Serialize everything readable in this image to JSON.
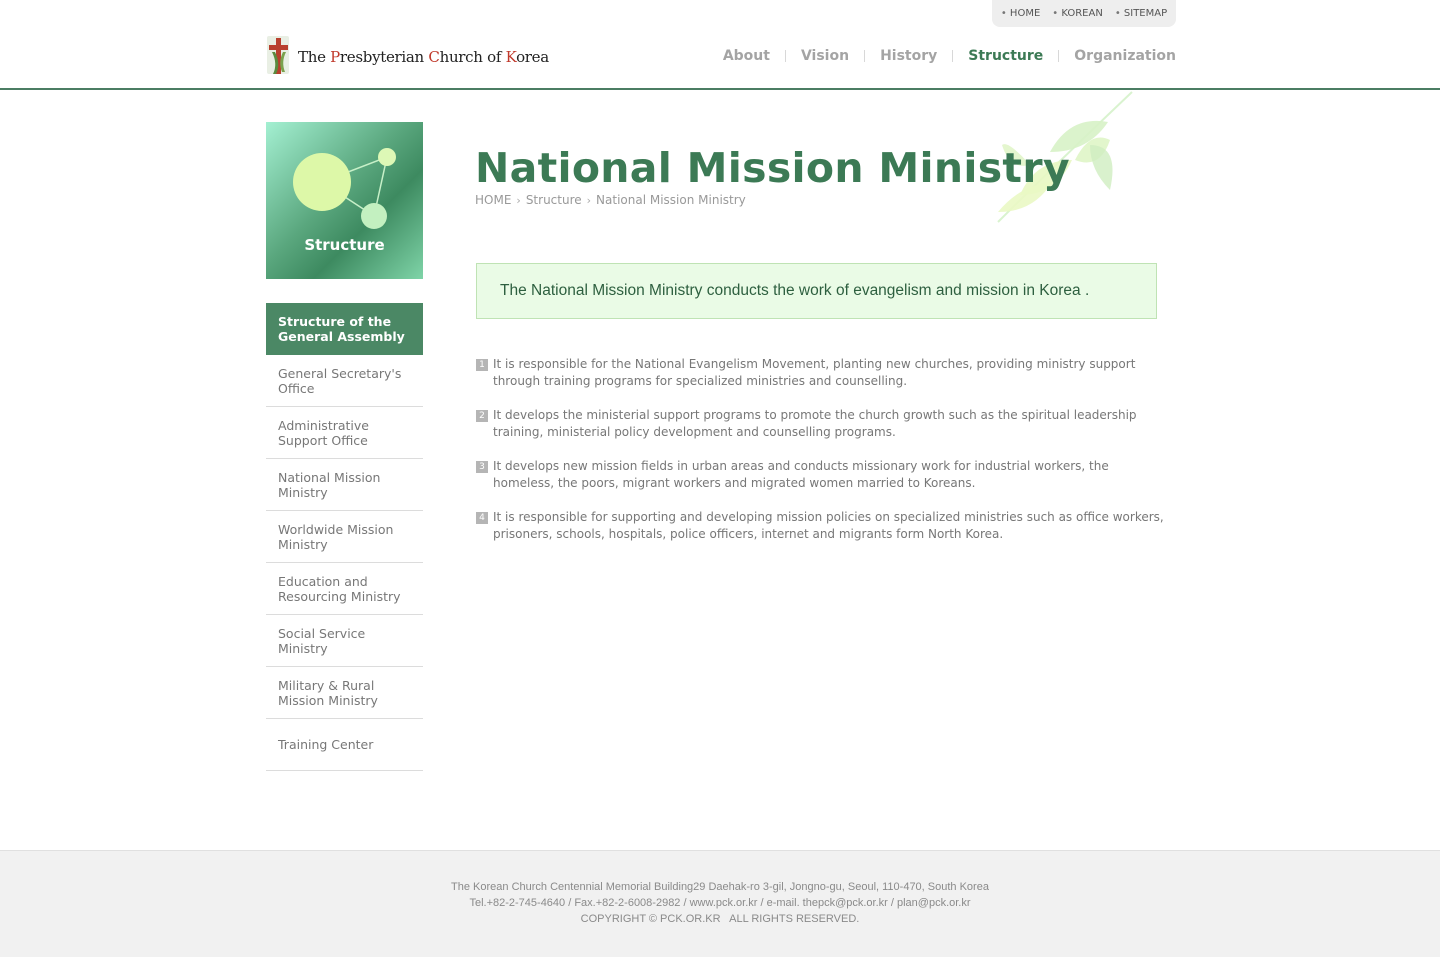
{
  "util_nav": [
    "HOME",
    "KOREAN",
    "SITEMAP"
  ],
  "logo": {
    "parts": [
      {
        "t": "The ",
        "red": false
      },
      {
        "t": "P",
        "red": true
      },
      {
        "t": "resbyterian ",
        "red": false
      },
      {
        "t": "C",
        "red": true
      },
      {
        "t": "hurch of ",
        "red": false
      },
      {
        "t": "K",
        "red": true
      },
      {
        "t": "orea",
        "red": false
      }
    ]
  },
  "gnb": {
    "items": [
      "About",
      "Vision",
      "History",
      "Structure",
      "Organization"
    ],
    "active": "Structure"
  },
  "side": {
    "visual_title": "Structure",
    "menu": [
      {
        "label": "Structure of the General Assembly",
        "active": true
      },
      {
        "label": "General Secretary's Office",
        "active": false
      },
      {
        "label": "Administrative Support Office",
        "active": false
      },
      {
        "label": "National Mission Ministry",
        "active": false
      },
      {
        "label": "Worldwide Mission Ministry",
        "active": false
      },
      {
        "label": "Education and Resourcing Ministry",
        "active": false
      },
      {
        "label": "Social Service Ministry",
        "active": false
      },
      {
        "label": "Military & Rural Mission Ministry",
        "active": false
      },
      {
        "label": "Training Center",
        "active": false
      }
    ]
  },
  "page": {
    "title": "National Mission Ministry",
    "breadcrumb": [
      "HOME",
      "Structure",
      "National Mission Ministry"
    ],
    "summary": "The National Mission Ministry conducts the work of evangelism and mission in Korea .",
    "points": [
      "It is responsible for the National Evangelism Movement, planting new churches, providing ministry support through training programs for specialized ministries and counselling.",
      "It develops the ministerial support programs to promote the church growth such as the spiritual leadership training, ministerial policy development and counselling programs.",
      "It develops new mission fields in urban areas and conducts missionary work for industrial workers, the homeless, the poors, migrant workers and migrated women married to Koreans.",
      "It is responsible for supporting and developing mission policies on specialized ministries such as office workers, prisoners, schools, hospitals, police officers, internet and migrants form North Korea."
    ]
  },
  "footer": {
    "address": "The Korean Church Centennial Memorial Building29 Daehak-ro 3-gil, Jongno-gu, Seoul, 110-470, South Korea",
    "contact": "Tel.+82-2-745-4640 / Fax.+82-2-6008-2982 / www.pck.or.kr / e-mail. thepck@pck.or.kr / plan@pck.or.kr",
    "copyright": "COPYRIGHT © PCK.OR.KR   ALL RIGHTS RESERVED."
  },
  "colors": {
    "brand_green": "#3c7a55",
    "header_line": "#4b7d63",
    "menu_active_bg": "#4b8865",
    "summary_bg": "#eafbe6",
    "logo_red": "#c0392b"
  },
  "icons": [
    "cross-logo-icon",
    "network-graphic-icon",
    "leaf-branch-icon",
    "chevron-right-icon"
  ]
}
